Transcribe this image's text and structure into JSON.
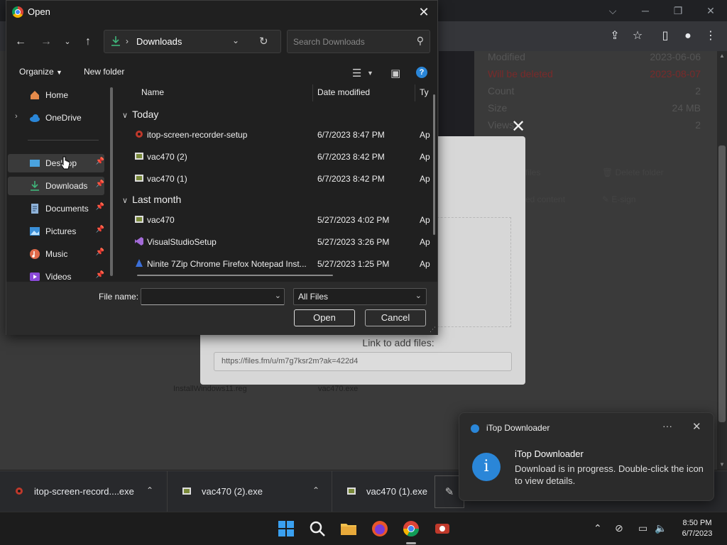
{
  "dialog": {
    "title": "Open",
    "address_crumb": "Downloads",
    "search_placeholder": "Search Downloads",
    "organize_label": "Organize",
    "new_folder_label": "New folder",
    "nav_items": [
      {
        "label": "Home",
        "pinned": false
      },
      {
        "label": "OneDrive",
        "pinned": false
      },
      {
        "label": "Desktop",
        "pinned": true
      },
      {
        "label": "Downloads",
        "pinned": true
      },
      {
        "label": "Documents",
        "pinned": true
      },
      {
        "label": "Pictures",
        "pinned": true
      },
      {
        "label": "Music",
        "pinned": true
      },
      {
        "label": "Videos",
        "pinned": true
      }
    ],
    "columns": {
      "name": "Name",
      "date_modified": "Date modified",
      "type": "Ty"
    },
    "groups": [
      {
        "label": "Today",
        "files": [
          {
            "name": "itop-screen-recorder-setup",
            "date": "6/7/2023 8:47 PM",
            "type": "Ap",
            "icon": "itop-icon"
          },
          {
            "name": "vac470 (2)",
            "date": "6/7/2023 8:42 PM",
            "type": "Ap",
            "icon": "installer-icon"
          },
          {
            "name": "vac470 (1)",
            "date": "6/7/2023 8:42 PM",
            "type": "Ap",
            "icon": "installer-icon"
          }
        ]
      },
      {
        "label": "Last month",
        "files": [
          {
            "name": "vac470",
            "date": "5/27/2023 4:02 PM",
            "type": "Ap",
            "icon": "installer-icon"
          },
          {
            "name": "VisualStudioSetup",
            "date": "5/27/2023 3:26 PM",
            "type": "Ap",
            "icon": "visual-studio-icon"
          },
          {
            "name": "Ninite 7Zip Chrome Firefox Notepad Inst...",
            "date": "5/27/2023 1:25 PM",
            "type": "Ap",
            "icon": "ninite-icon"
          }
        ]
      }
    ],
    "file_name_label": "File name:",
    "file_name_value": "",
    "filter_value": "All Files",
    "open_label": "Open",
    "cancel_label": "Cancel"
  },
  "page": {
    "info_rows": [
      {
        "label": "Modified",
        "value": "2023-06-06",
        "red": false
      },
      {
        "label": "Will be deleted",
        "value": "2023-08-07",
        "red": true
      },
      {
        "label": "Count",
        "value": "2",
        "red": false
      },
      {
        "label": "Size",
        "value": "24 MB",
        "red": false
      },
      {
        "label": "Views",
        "value": "2",
        "red": false
      }
    ],
    "actions": {
      "files": "files",
      "delete_folder": "Delete folder",
      "content": "ed content",
      "esign": "E-sign"
    },
    "link_label": "Link to add files:",
    "link_value": "https://files.fm/u/m7g7ksr2m?ak=422d4",
    "bg_files": [
      "InstallWindows11.reg",
      "vac470.exe"
    ]
  },
  "downloads": [
    {
      "name": "itop-screen-record....exe"
    },
    {
      "name": "vac470 (2).exe"
    },
    {
      "name": "vac470 (1).exe"
    }
  ],
  "toast": {
    "app_name": "iTop Downloader",
    "title": "iTop Downloader",
    "body": "Download is in progress. Double-click the icon to view details."
  },
  "taskbar": {
    "time": "8:50 PM",
    "date": "6/7/2023"
  },
  "colors": {
    "accent": "#2a86d8",
    "dialog_bg": "#202020",
    "folder_green": "#3fb57a"
  }
}
